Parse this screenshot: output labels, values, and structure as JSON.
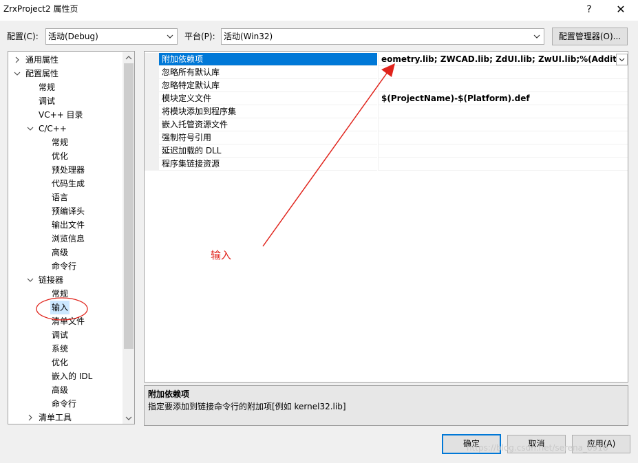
{
  "window": {
    "title": "ZrxProject2 属性页",
    "help_glyph": "?",
    "close_glyph": "✕"
  },
  "toolbar": {
    "config_label": "配置(C):",
    "config_value": "活动(Debug)",
    "platform_label": "平台(P):",
    "platform_value": "活动(Win32)",
    "config_manager_label": "配置管理器(O)..."
  },
  "tree": {
    "items": [
      {
        "label": "通用属性",
        "expanded": false
      },
      {
        "label": "配置属性",
        "expanded": true
      },
      {
        "label": "常规"
      },
      {
        "label": "调试"
      },
      {
        "label": "VC++ 目录"
      },
      {
        "label": "C/C++",
        "expanded": true
      },
      {
        "label": "常规"
      },
      {
        "label": "优化"
      },
      {
        "label": "预处理器"
      },
      {
        "label": "代码生成"
      },
      {
        "label": "语言"
      },
      {
        "label": "预编译头"
      },
      {
        "label": "输出文件"
      },
      {
        "label": "浏览信息"
      },
      {
        "label": "高级"
      },
      {
        "label": "命令行"
      },
      {
        "label": "链接器",
        "expanded": true
      },
      {
        "label": "常规"
      },
      {
        "label": "输入",
        "selected": true
      },
      {
        "label": "清单文件"
      },
      {
        "label": "调试"
      },
      {
        "label": "系统"
      },
      {
        "label": "优化"
      },
      {
        "label": "嵌入的 IDL"
      },
      {
        "label": "高级"
      },
      {
        "label": "命令行"
      },
      {
        "label": "清单工具",
        "expanded": false
      }
    ]
  },
  "grid": {
    "rows": [
      {
        "name": "附加依赖项",
        "value": "eometry.lib; ZWCAD.lib; ZdUI.lib; ZwUI.lib;%(AdditionalI",
        "selected": true
      },
      {
        "name": "忽略所有默认库",
        "value": ""
      },
      {
        "name": "忽略特定默认库",
        "value": ""
      },
      {
        "name": "模块定义文件",
        "value": "$(ProjectName)-$(Platform).def"
      },
      {
        "name": "将模块添加到程序集",
        "value": ""
      },
      {
        "name": "嵌入托管资源文件",
        "value": ""
      },
      {
        "name": "强制符号引用",
        "value": ""
      },
      {
        "name": "延迟加载的 DLL",
        "value": ""
      },
      {
        "name": "程序集链接资源",
        "value": ""
      }
    ]
  },
  "description": {
    "title": "附加依赖项",
    "text": "指定要添加到链接命令行的附加项[例如 kernel32.lib]"
  },
  "buttons": {
    "ok": "确定",
    "cancel": "取消",
    "apply": "应用(A)"
  },
  "annotation": {
    "label": "输入",
    "color": "#e0231b"
  },
  "watermark": "https://blog.csdn.net/serena_0916",
  "colors": {
    "selection": "#0078d7",
    "tree_selection": "#cce8ff"
  }
}
